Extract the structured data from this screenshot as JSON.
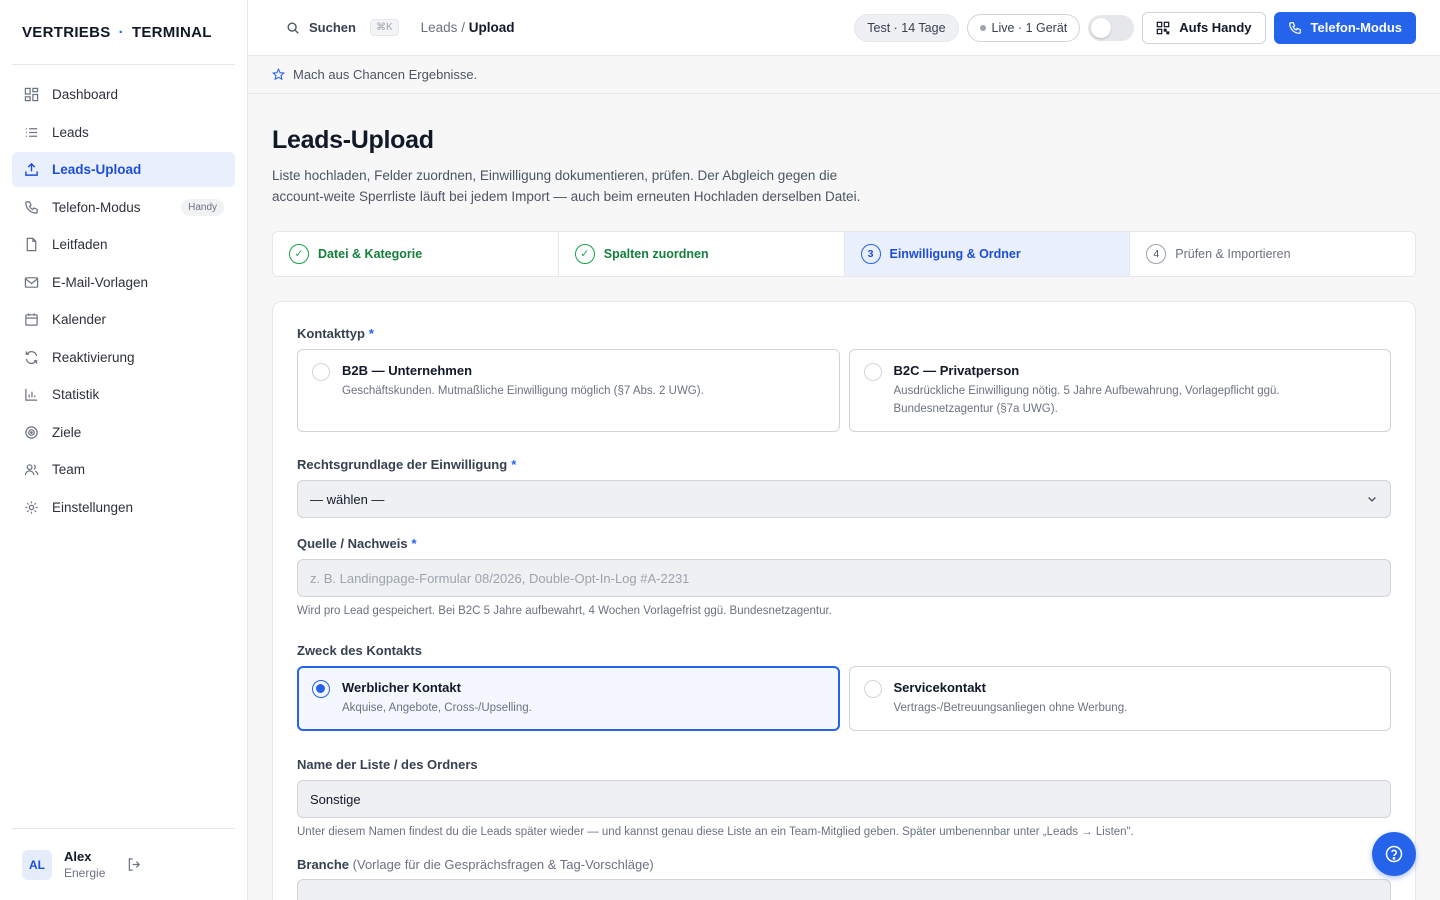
{
  "brand": {
    "left": "VERTRIEBS",
    "dot": "·",
    "right": "TERMINAL"
  },
  "sidebar": {
    "items": [
      {
        "label": "Dashboard",
        "icon": "grid-icon"
      },
      {
        "label": "Leads",
        "icon": "list-icon"
      },
      {
        "label": "Leads-Upload",
        "icon": "upload-icon",
        "active": true
      },
      {
        "label": "Telefon-Modus",
        "icon": "phone-icon",
        "badge": "Handy"
      },
      {
        "label": "Leitfaden",
        "icon": "document-icon"
      },
      {
        "label": "E-Mail-Vorlagen",
        "icon": "mail-icon"
      },
      {
        "label": "Kalender",
        "icon": "calendar-icon"
      },
      {
        "label": "Reaktivierung",
        "icon": "refresh-icon"
      },
      {
        "label": "Statistik",
        "icon": "bar-chart-icon"
      },
      {
        "label": "Ziele",
        "icon": "target-icon"
      },
      {
        "label": "Team",
        "icon": "users-icon"
      },
      {
        "label": "Einstellungen",
        "icon": "gear-icon"
      }
    ],
    "user": {
      "initials": "AL",
      "name": "Alex",
      "role": "Energie"
    }
  },
  "topbar": {
    "search_label": "Suchen",
    "search_shortcut": "⌘K",
    "breadcrumb_parent": "Leads",
    "breadcrumb_sep": "/",
    "breadcrumb_current": "Upload",
    "trial": "Test · 14 Tage",
    "live": "Live · 1 Gerät",
    "mobile_button": "Aufs Handy",
    "phone_button": "Telefon-Modus"
  },
  "banner": {
    "text": "Mach aus Chancen Ergebnisse."
  },
  "page": {
    "title": "Leads-Upload",
    "description": "Liste hochladen, Felder zuordnen, Einwilligung dokumentieren, prüfen. Der Abgleich gegen die account-weite Sperrliste läuft bei jedem Import — auch beim erneuten Hochladen derselben Datei."
  },
  "steps": [
    {
      "num": "✓",
      "label": "Datei & Kategorie",
      "state": "done"
    },
    {
      "num": "✓",
      "label": "Spalten zuordnen",
      "state": "done"
    },
    {
      "num": "3",
      "label": "Einwilligung & Ordner",
      "state": "current"
    },
    {
      "num": "4",
      "label": "Prüfen & Importieren",
      "state": "todo"
    }
  ],
  "form": {
    "contact_type": {
      "label": "Kontakttyp",
      "required": "*",
      "options": [
        {
          "title": "B2B — Unternehmen",
          "desc": "Geschäftskunden. Mutmaßliche Einwilligung möglich (§7 Abs. 2 UWG).",
          "selected": false
        },
        {
          "title": "B2C — Privatperson",
          "desc": "Ausdrückliche Einwilligung nötig. 5 Jahre Aufbewahrung, Vorlagepflicht ggü. Bundesnetzagentur (§7a UWG).",
          "selected": false
        }
      ]
    },
    "legal_basis": {
      "label": "Rechtsgrundlage der Einwilligung",
      "required": "*",
      "value": "— wählen —"
    },
    "source": {
      "label": "Quelle / Nachweis",
      "required": "*",
      "placeholder": "z. B. Landingpage-Formular 08/2026, Double-Opt-In-Log #A-2231",
      "help": "Wird pro Lead gespeichert. Bei B2C 5 Jahre aufbewahrt, 4 Wochen Vorlagefrist ggü. Bundesnetzagentur."
    },
    "purpose": {
      "label": "Zweck des Kontakts",
      "options": [
        {
          "title": "Werblicher Kontakt",
          "desc": "Akquise, Angebote, Cross-/Upselling.",
          "selected": true
        },
        {
          "title": "Servicekontakt",
          "desc": "Vertrags-/Betreuungsanliegen ohne Werbung.",
          "selected": false
        }
      ]
    },
    "list_name": {
      "label": "Name der Liste / des Ordners",
      "value": "Sonstige",
      "help": "Unter diesem Namen findest du die Leads später wieder — und kannst genau diese Liste an ein Team-Mitglied geben. Später umbenennbar unter „Leads → Listen\"."
    },
    "industry": {
      "label": "Branche",
      "hint": "(Vorlage für die Gesprächsfragen & Tag-Vorschläge)"
    }
  },
  "colors": {
    "accent": "#2563eb",
    "success": "#16a34a",
    "active_bg": "#eaf0fb"
  }
}
